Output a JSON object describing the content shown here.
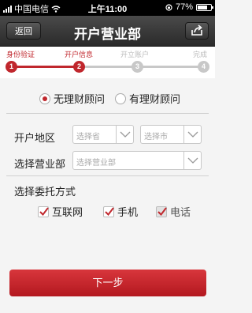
{
  "status_bar": {
    "carrier": "中国电信",
    "time": "上午11:00",
    "battery": "77%",
    "battery_level": 0.77
  },
  "nav": {
    "back_label": "返回",
    "title": "开户营业部",
    "share_icon": "share-icon"
  },
  "steps": [
    {
      "label": "身份验证",
      "number": "1",
      "state": "done"
    },
    {
      "label": "开户信息",
      "number": "2",
      "state": "current"
    },
    {
      "label": "开立账户",
      "number": "3",
      "state": "pending"
    },
    {
      "label": "完成",
      "number": "4",
      "state": "pending"
    }
  ],
  "advisor": {
    "options": [
      {
        "label": "无理财顾问",
        "selected": true
      },
      {
        "label": "有理财顾问",
        "selected": false
      }
    ]
  },
  "region": {
    "label": "开户地区",
    "province_placeholder": "选择省",
    "city_placeholder": "选择市"
  },
  "branch": {
    "label": "选择营业部",
    "placeholder": "选择营业部"
  },
  "delegation": {
    "label": "选择委托方式",
    "options": [
      {
        "label": "互联网",
        "checked": true
      },
      {
        "label": "手机",
        "checked": true
      },
      {
        "label": "电话",
        "checked": true,
        "disabled": true
      }
    ]
  },
  "next_label": "下一步",
  "colors": {
    "accent": "#c0272d",
    "inactive": "#c8c8c8"
  }
}
